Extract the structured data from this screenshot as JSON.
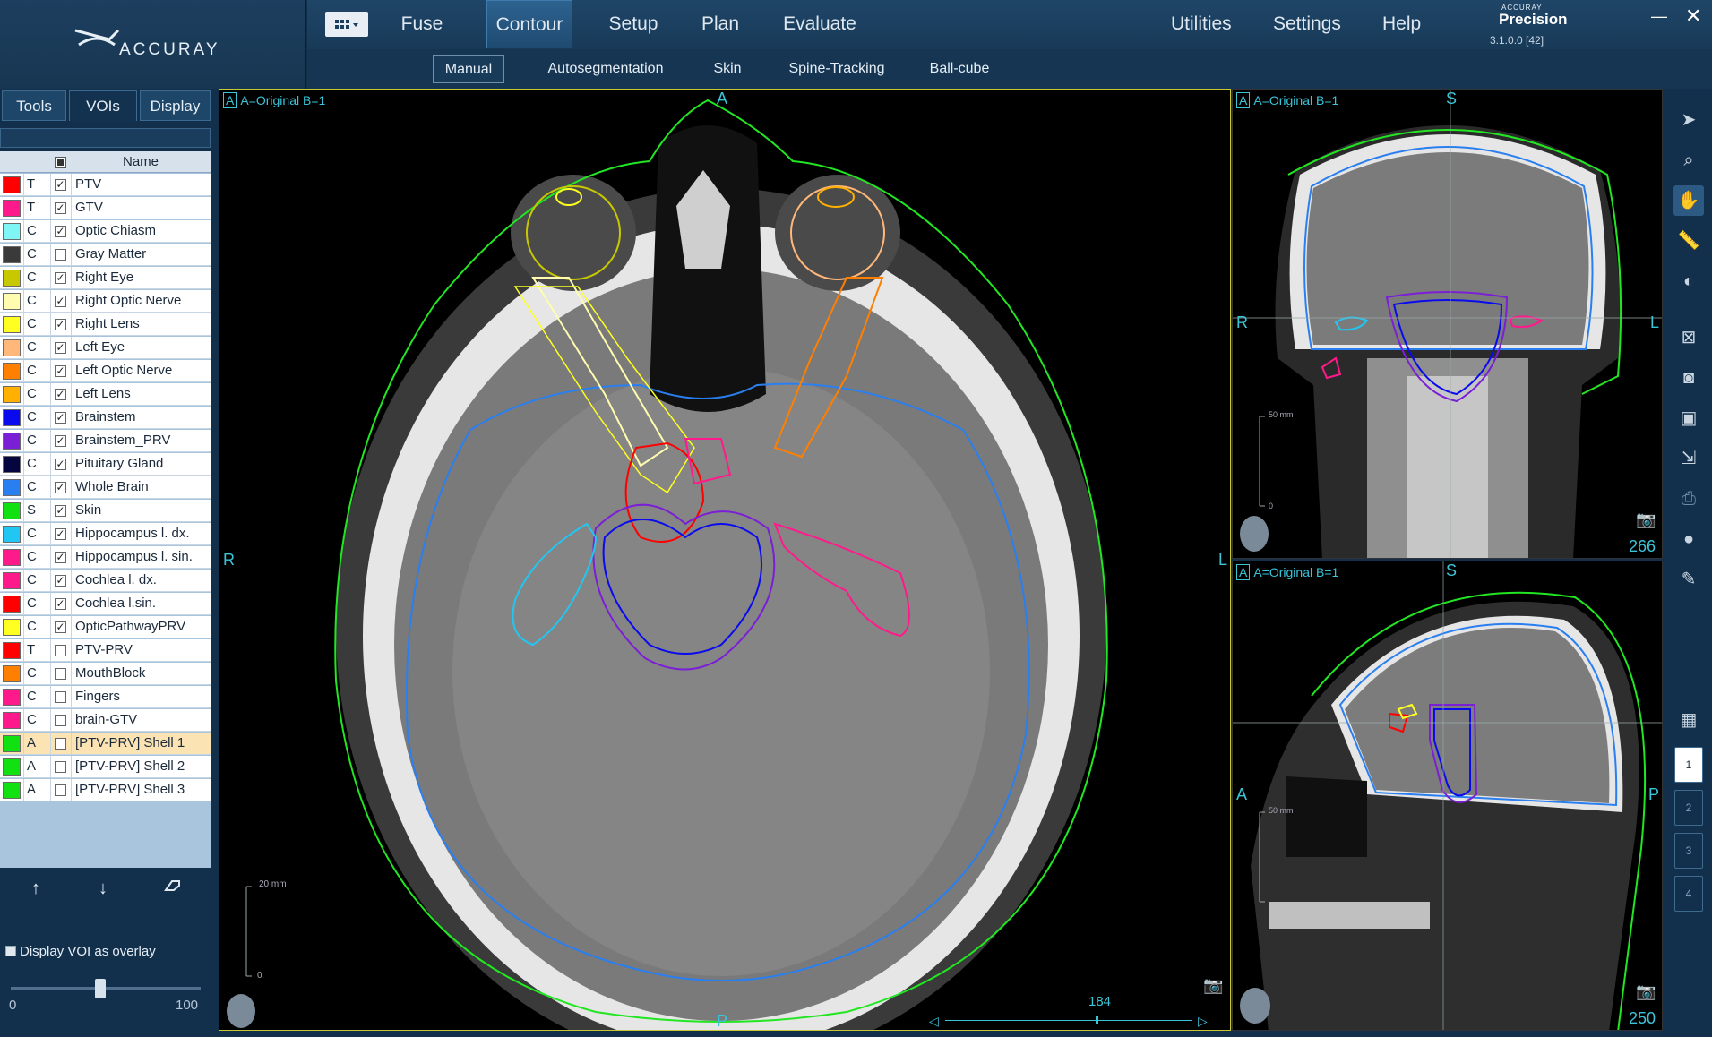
{
  "header": {
    "logo_text": "ACCURAY",
    "nav_tabs": [
      {
        "label": "Fuse",
        "active": false
      },
      {
        "label": "Contour",
        "active": true
      },
      {
        "label": "Setup",
        "active": false
      },
      {
        "label": "Plan",
        "active": false
      },
      {
        "label": "Evaluate",
        "active": false
      }
    ],
    "utilities": [
      "Utilities",
      "Settings",
      "Help"
    ],
    "brand_small": "ACCURAY",
    "brand_name": "Precision",
    "version": "3.1.0.0 [42]"
  },
  "subnav": {
    "tabs": [
      {
        "label": "Manual",
        "active": true
      },
      {
        "label": "Autosegmentation",
        "active": false
      },
      {
        "label": "Skin",
        "active": false
      },
      {
        "label": "Spine-Tracking",
        "active": false
      },
      {
        "label": "Ball-cube",
        "active": false
      }
    ]
  },
  "left_panel": {
    "tabs": [
      {
        "label": "Tools",
        "active": false
      },
      {
        "label": "VOIs",
        "active": true
      },
      {
        "label": "Display",
        "active": false
      }
    ],
    "table_header": "Name",
    "vois": [
      {
        "color": "#ff0000",
        "type": "T",
        "checked": true,
        "name": "PTV"
      },
      {
        "color": "#ff1a8c",
        "type": "T",
        "checked": true,
        "name": "GTV"
      },
      {
        "color": "#7ff5f5",
        "type": "C",
        "checked": true,
        "name": "Optic Chiasm"
      },
      {
        "color": "#3a3a3a",
        "type": "C",
        "checked": false,
        "name": "Gray Matter"
      },
      {
        "color": "#c8c800",
        "type": "C",
        "checked": true,
        "name": "Right Eye"
      },
      {
        "color": "#fffcb0",
        "type": "C",
        "checked": true,
        "name": "Right Optic Nerve"
      },
      {
        "color": "#ffff22",
        "type": "C",
        "checked": true,
        "name": "Right Lens"
      },
      {
        "color": "#ffb87a",
        "type": "C",
        "checked": true,
        "name": "Left Eye"
      },
      {
        "color": "#ff7f00",
        "type": "C",
        "checked": true,
        "name": "Left Optic Nerve"
      },
      {
        "color": "#ffb000",
        "type": "C",
        "checked": true,
        "name": "Left Lens"
      },
      {
        "color": "#0a0aee",
        "type": "C",
        "checked": true,
        "name": "Brainstem"
      },
      {
        "color": "#7b1fd6",
        "type": "C",
        "checked": true,
        "name": "Brainstem_PRV"
      },
      {
        "color": "#050540",
        "type": "C",
        "checked": true,
        "name": "Pituitary Gland"
      },
      {
        "color": "#2a7ff0",
        "type": "C",
        "checked": true,
        "name": "Whole Brain"
      },
      {
        "color": "#11e011",
        "type": "S",
        "checked": true,
        "name": "Skin"
      },
      {
        "color": "#22c6f2",
        "type": "C",
        "checked": true,
        "name": "Hippocampus l. dx."
      },
      {
        "color": "#ff1a8c",
        "type": "C",
        "checked": true,
        "name": "Hippocampus l. sin."
      },
      {
        "color": "#ff1a8c",
        "type": "C",
        "checked": true,
        "name": "Cochlea l. dx."
      },
      {
        "color": "#ff0000",
        "type": "C",
        "checked": true,
        "name": "Cochlea l.sin."
      },
      {
        "color": "#ffff22",
        "type": "C",
        "checked": true,
        "name": "OpticPathwayPRV"
      },
      {
        "color": "#ff0000",
        "type": "T",
        "checked": false,
        "name": "PTV-PRV"
      },
      {
        "color": "#ff7f00",
        "type": "C",
        "checked": false,
        "name": "MouthBlock"
      },
      {
        "color": "#ff1a8c",
        "type": "C",
        "checked": false,
        "name": "Fingers"
      },
      {
        "color": "#ff1a8c",
        "type": "C",
        "checked": false,
        "name": "brain-GTV"
      },
      {
        "color": "#11e011",
        "type": "A",
        "checked": false,
        "name": "[PTV-PRV] Shell 1",
        "selected": true
      },
      {
        "color": "#11e011",
        "type": "A",
        "checked": false,
        "name": "[PTV-PRV] Shell 2"
      },
      {
        "color": "#11e011",
        "type": "A",
        "checked": false,
        "name": "[PTV-PRV] Shell 3"
      }
    ],
    "overlay_label": "Display VOI as overlay",
    "opacity_min": "0",
    "opacity_max": "100",
    "opacity_value": 0.47
  },
  "viewports": {
    "axial": {
      "label": "A=Original B=1",
      "box_letter": "A",
      "top": "A",
      "bottom": "P",
      "left": "R",
      "right": "L",
      "slice": "184",
      "scale_label": "20 mm",
      "scale_zero": "0"
    },
    "coronal": {
      "label": "A=Original B=1",
      "box_letter": "A",
      "top": "S",
      "left": "R",
      "right": "L",
      "slice": "266",
      "scale_label": "50 mm",
      "scale_zero": "0"
    },
    "sagittal": {
      "label": "A=Original B=1",
      "box_letter": "A",
      "top": "S",
      "left": "A",
      "right": "P",
      "slice": "250",
      "scale_label": "50 mm"
    }
  },
  "right_toolbar": {
    "pages": [
      "1",
      "2",
      "3",
      "4"
    ]
  }
}
